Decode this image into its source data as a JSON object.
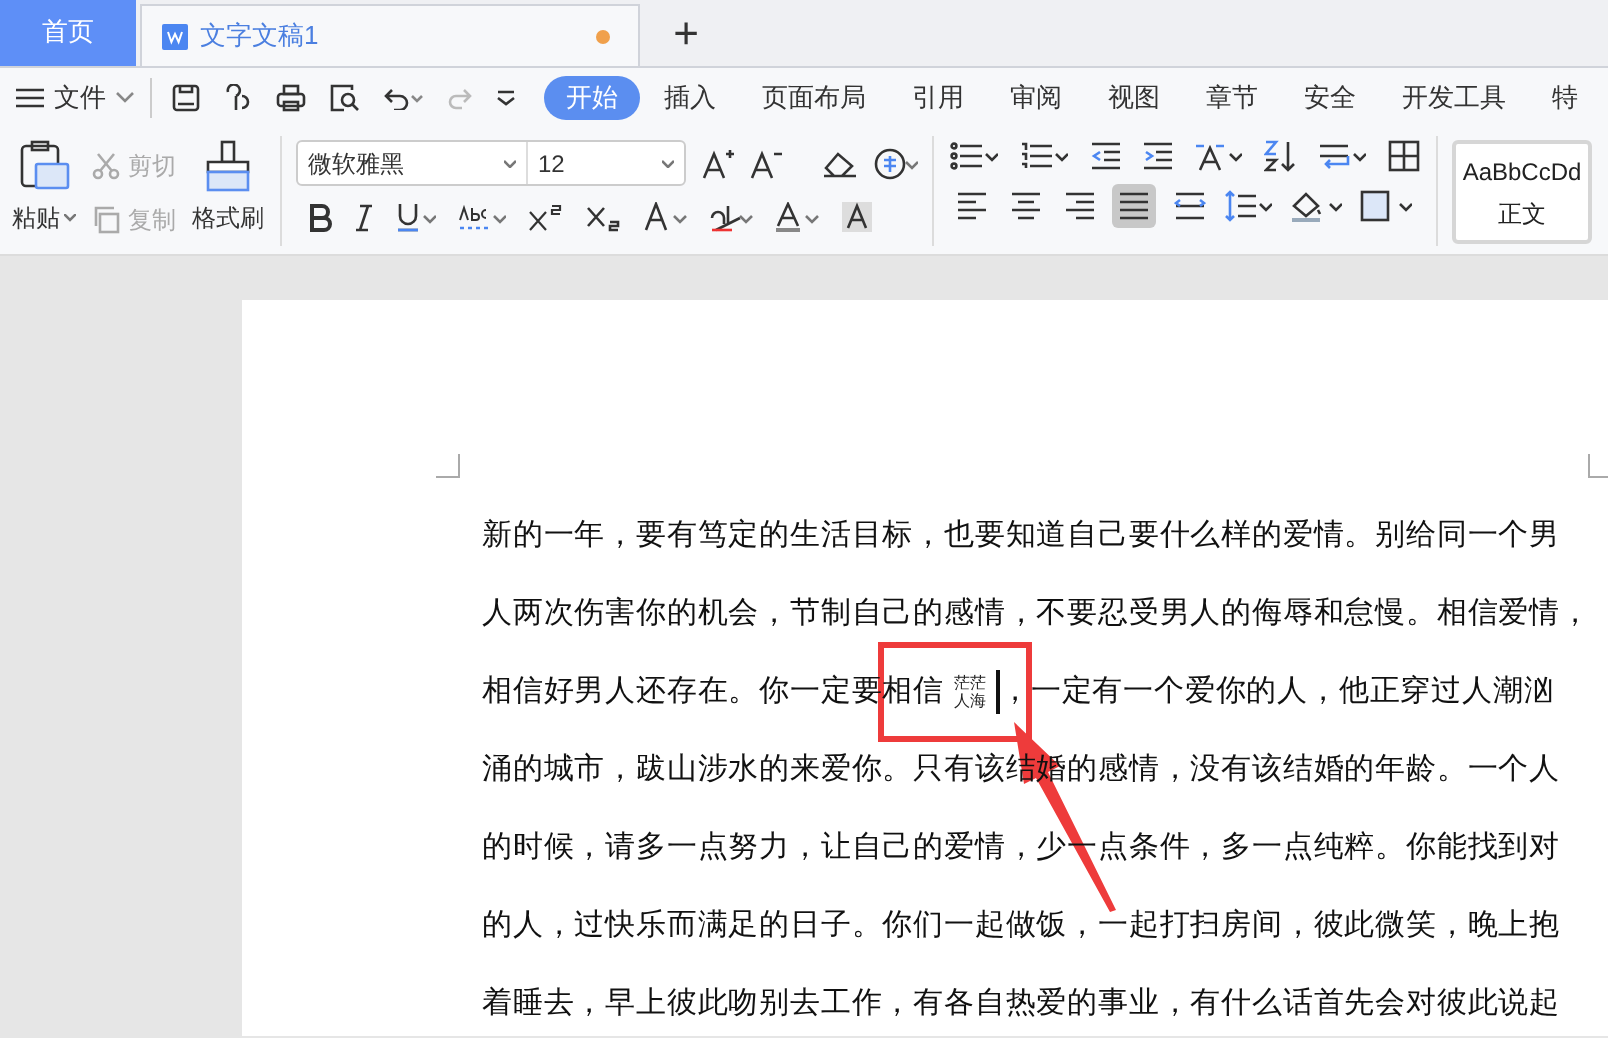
{
  "tabs": [
    {
      "label": "首页",
      "kind": "home",
      "selected": false
    },
    {
      "label": "文字文稿1",
      "kind": "document",
      "selected": true,
      "unsaved": true
    }
  ],
  "new_tab": "+",
  "file_menu": "文件",
  "ribbon_tabs": [
    {
      "label": "开始",
      "selected": true
    },
    {
      "label": "插入",
      "selected": false
    },
    {
      "label": "页面布局",
      "selected": false
    },
    {
      "label": "引用",
      "selected": false
    },
    {
      "label": "审阅",
      "selected": false
    },
    {
      "label": "视图",
      "selected": false
    },
    {
      "label": "章节",
      "selected": false
    },
    {
      "label": "安全",
      "selected": false
    },
    {
      "label": "开发工具",
      "selected": false
    },
    {
      "label": "特",
      "selected": false
    }
  ],
  "clipboard": {
    "paste": "粘贴",
    "cut": {
      "label": "剪切",
      "disabled": true
    },
    "copy": {
      "label": "复制",
      "disabled": true
    },
    "format_painter": "格式刷"
  },
  "font": {
    "name": "微软雅黑",
    "size": "12"
  },
  "alignment": [
    {
      "selected": false
    },
    {
      "selected": false
    },
    {
      "selected": false
    },
    {
      "selected": true
    }
  ],
  "style_preview": {
    "sample": "AaBbCcDd",
    "name": "正文"
  },
  "document": {
    "lines": [
      {
        "segments": [
          {
            "kind": "text",
            "text": "新的一年，要有笃定的生活目标，也要知道自己要什么样的爱情。别给同一个男"
          }
        ]
      },
      {
        "segments": [
          {
            "kind": "text",
            "text": "人两次伤害你的机会，节制自己的感情，不要忍受男人的侮辱和怠慢。相信爱情，"
          }
        ]
      },
      {
        "segments": [
          {
            "kind": "text",
            "text": "相信好男人还存在。你一定要相信"
          },
          {
            "kind": "combined",
            "top": "茫茫",
            "bottom": "人海",
            "caret_after": true
          },
          {
            "kind": "text",
            "text": "，一定有一个爱你的人，他正穿过人潮汹"
          }
        ]
      },
      {
        "segments": [
          {
            "kind": "text",
            "text": "涌的城市，跋山涉水的来爱你。只有该结婚的感情，没有该结婚的年龄。一个人"
          }
        ]
      },
      {
        "segments": [
          {
            "kind": "text",
            "text": "的时候，请多一点努力，让自己的爱情，少一点条件，多一点纯粹。你能找到对"
          }
        ]
      },
      {
        "segments": [
          {
            "kind": "text",
            "text": "的人，过快乐而满足的日子。你们一起做饭，一起打扫房间，彼此微笑，晚上抱"
          }
        ]
      },
      {
        "segments": [
          {
            "kind": "text",
            "text": "着睡去，早上彼此吻别去工作，有各自热爱的事业，有什么话首先会对彼此说起"
          }
        ]
      }
    ]
  }
}
